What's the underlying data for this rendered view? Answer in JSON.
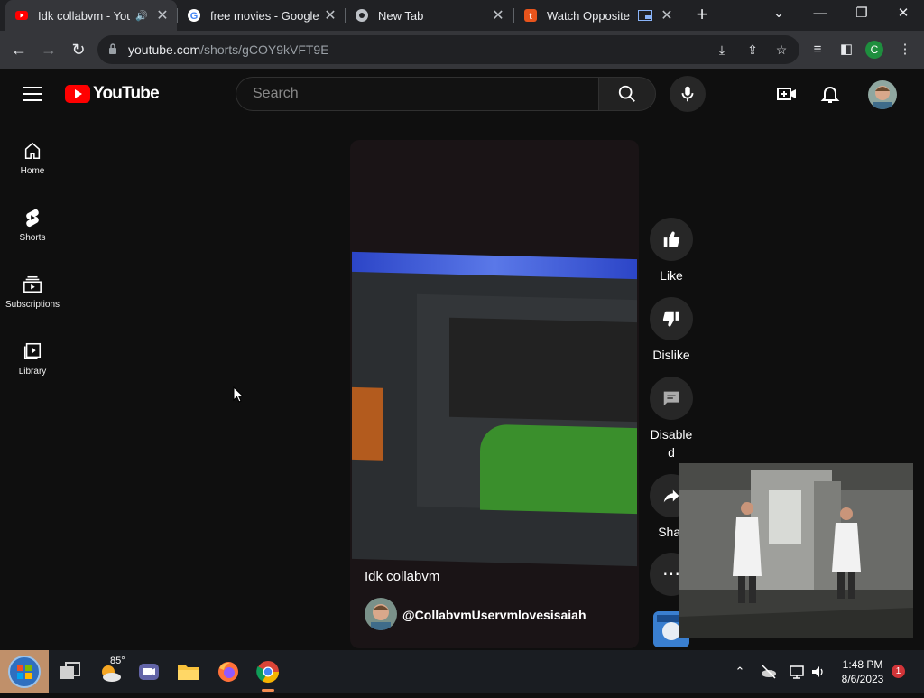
{
  "browser": {
    "tabs": [
      {
        "title": "Idk collabvm - You",
        "favicon": "youtube-icon",
        "active": true,
        "audio": true
      },
      {
        "title": "free movies - Google S",
        "favicon": "google-icon",
        "active": false
      },
      {
        "title": "New Tab",
        "favicon": "chrome-icon",
        "active": false
      },
      {
        "title": "Watch Opposite D",
        "favicon": "tubi-icon",
        "active": false
      }
    ],
    "new_tab_label": "+",
    "url_host": "youtube.com",
    "url_path": "/shorts/gCOY9kVFT9E",
    "profile_initial": "C"
  },
  "youtube": {
    "logo_text": "YouTube",
    "search_placeholder": "Search",
    "guide": [
      {
        "label": "Home",
        "icon": "home-icon"
      },
      {
        "label": "Shorts",
        "icon": "shorts-icon"
      },
      {
        "label": "Subscriptions",
        "icon": "subscriptions-icon"
      },
      {
        "label": "Library",
        "icon": "library-icon"
      }
    ],
    "short": {
      "title": "Idk collabvm",
      "channel": "@CollabvmUservmlovesisaiah"
    },
    "actions": {
      "like": "Like",
      "dislike": "Dislike",
      "comments_l1": "Disable",
      "comments_l2": "d",
      "share": "Shar"
    }
  },
  "taskbar": {
    "weather_temp": "85°",
    "time": "1:48 PM",
    "date": "8/6/2023",
    "notification_count": "1"
  },
  "colors": {
    "youtube_red": "#ff0000",
    "chrome_dark": "#202124",
    "page_bg": "#0f0f0f"
  }
}
